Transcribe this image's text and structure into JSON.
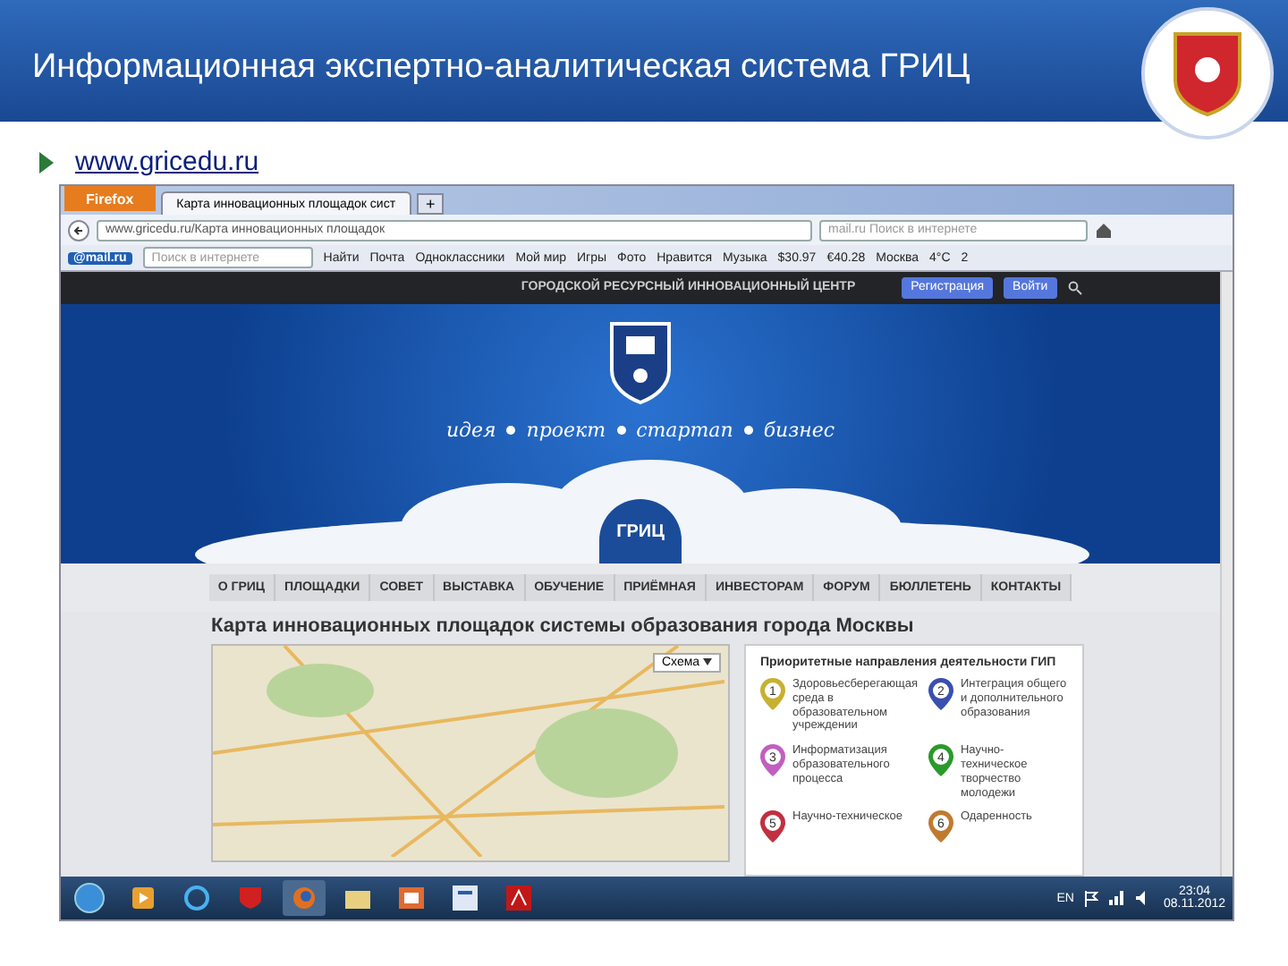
{
  "slide": {
    "title": "Информационная экспертно-аналитическая система ГРИЦ",
    "bullet": "www.gricedu.ru"
  },
  "browser": {
    "menu_button": "Firefox",
    "tabs": [
      {
        "label": "Карта инновационных площадок сист",
        "selected": true
      }
    ],
    "new_tab": "+",
    "address": "www.gricedu.ru/Карта инновационных площадок",
    "search_placeholder": "mail.ru Поиск в интернете"
  },
  "mail_toolbar": {
    "logo": "@mail.ru",
    "search_placeholder": "Поиск в интернете",
    "search_button": "Найти",
    "links": [
      "Почта",
      "Одноклассники",
      "Мой мир",
      "Игры",
      "Фото",
      "Нравится",
      "Музыка"
    ],
    "usd": "$30.97",
    "eur": "€40.28",
    "city": "Москва",
    "temperature": "4°C",
    "count": "2"
  },
  "site": {
    "header_title": "ГОРОДСКОЙ РЕСУРСНЫЙ ИННОВАЦИОННЫЙ ЦЕНТР",
    "buttons": [
      "Регистрация",
      "Войти"
    ],
    "slogan": [
      "идея",
      "проект",
      "стартап",
      "бизнес"
    ],
    "logo_text": "ГРИЦ",
    "nav": [
      "О ГРИЦ",
      "ПЛОЩАДКИ",
      "СОВЕТ",
      "ВЫСТАВКА",
      "ОБУЧЕНИЕ",
      "ПРИЁМНАЯ",
      "ИНВЕСТОРАМ",
      "ФОРУМ",
      "БЮЛЛЕТЕНЬ",
      "КОНТАКТЫ"
    ],
    "page_title": "Карта инновационных площадок системы образования города Москвы",
    "map": {
      "layer_button": "Схема"
    },
    "legend": {
      "title": "Приоритетные направления деятельности ГИП",
      "items": [
        {
          "number": "1",
          "label": "Здоровьесберегающая среда в образовательном учреждении",
          "color": "#c8b030"
        },
        {
          "number": "2",
          "label": "Интеграция общего и дополнительного образования",
          "color": "#3a4fb0"
        },
        {
          "number": "3",
          "label": "Информатизация образовательного процесса",
          "color": "#c060c0"
        },
        {
          "number": "4",
          "label": "Научно-техническое творчество молодежи",
          "color": "#2a9a2a"
        },
        {
          "number": "5",
          "label": "Научно-техническое",
          "color": "#c03040"
        },
        {
          "number": "6",
          "label": "Одаренность",
          "color": "#c07a30"
        }
      ]
    }
  },
  "taskbar": {
    "language": "EN",
    "time": "23:04",
    "date": "08.11.2012"
  }
}
